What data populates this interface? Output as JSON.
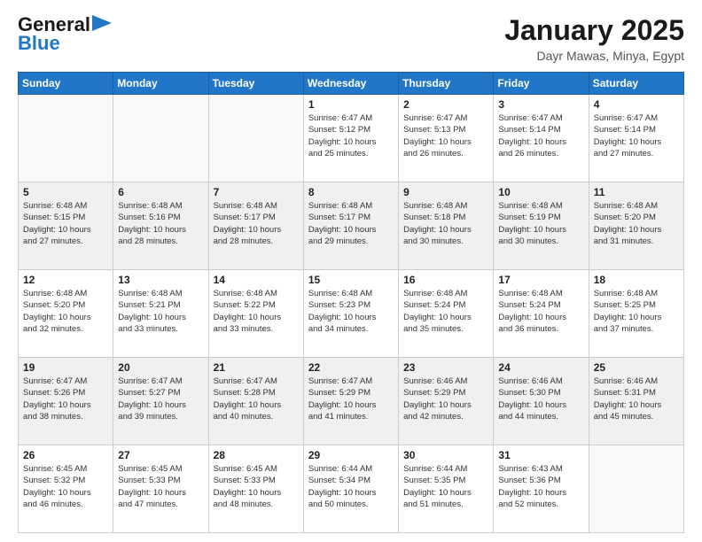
{
  "header": {
    "logo_line1": "General",
    "logo_line2": "Blue",
    "month_title": "January 2025",
    "location": "Dayr Mawas, Minya, Egypt"
  },
  "days_of_week": [
    "Sunday",
    "Monday",
    "Tuesday",
    "Wednesday",
    "Thursday",
    "Friday",
    "Saturday"
  ],
  "weeks": [
    [
      {
        "day": "",
        "info": ""
      },
      {
        "day": "",
        "info": ""
      },
      {
        "day": "",
        "info": ""
      },
      {
        "day": "1",
        "info": "Sunrise: 6:47 AM\nSunset: 5:12 PM\nDaylight: 10 hours\nand 25 minutes."
      },
      {
        "day": "2",
        "info": "Sunrise: 6:47 AM\nSunset: 5:13 PM\nDaylight: 10 hours\nand 26 minutes."
      },
      {
        "day": "3",
        "info": "Sunrise: 6:47 AM\nSunset: 5:14 PM\nDaylight: 10 hours\nand 26 minutes."
      },
      {
        "day": "4",
        "info": "Sunrise: 6:47 AM\nSunset: 5:14 PM\nDaylight: 10 hours\nand 27 minutes."
      }
    ],
    [
      {
        "day": "5",
        "info": "Sunrise: 6:48 AM\nSunset: 5:15 PM\nDaylight: 10 hours\nand 27 minutes."
      },
      {
        "day": "6",
        "info": "Sunrise: 6:48 AM\nSunset: 5:16 PM\nDaylight: 10 hours\nand 28 minutes."
      },
      {
        "day": "7",
        "info": "Sunrise: 6:48 AM\nSunset: 5:17 PM\nDaylight: 10 hours\nand 28 minutes."
      },
      {
        "day": "8",
        "info": "Sunrise: 6:48 AM\nSunset: 5:17 PM\nDaylight: 10 hours\nand 29 minutes."
      },
      {
        "day": "9",
        "info": "Sunrise: 6:48 AM\nSunset: 5:18 PM\nDaylight: 10 hours\nand 30 minutes."
      },
      {
        "day": "10",
        "info": "Sunrise: 6:48 AM\nSunset: 5:19 PM\nDaylight: 10 hours\nand 30 minutes."
      },
      {
        "day": "11",
        "info": "Sunrise: 6:48 AM\nSunset: 5:20 PM\nDaylight: 10 hours\nand 31 minutes."
      }
    ],
    [
      {
        "day": "12",
        "info": "Sunrise: 6:48 AM\nSunset: 5:20 PM\nDaylight: 10 hours\nand 32 minutes."
      },
      {
        "day": "13",
        "info": "Sunrise: 6:48 AM\nSunset: 5:21 PM\nDaylight: 10 hours\nand 33 minutes."
      },
      {
        "day": "14",
        "info": "Sunrise: 6:48 AM\nSunset: 5:22 PM\nDaylight: 10 hours\nand 33 minutes."
      },
      {
        "day": "15",
        "info": "Sunrise: 6:48 AM\nSunset: 5:23 PM\nDaylight: 10 hours\nand 34 minutes."
      },
      {
        "day": "16",
        "info": "Sunrise: 6:48 AM\nSunset: 5:24 PM\nDaylight: 10 hours\nand 35 minutes."
      },
      {
        "day": "17",
        "info": "Sunrise: 6:48 AM\nSunset: 5:24 PM\nDaylight: 10 hours\nand 36 minutes."
      },
      {
        "day": "18",
        "info": "Sunrise: 6:48 AM\nSunset: 5:25 PM\nDaylight: 10 hours\nand 37 minutes."
      }
    ],
    [
      {
        "day": "19",
        "info": "Sunrise: 6:47 AM\nSunset: 5:26 PM\nDaylight: 10 hours\nand 38 minutes."
      },
      {
        "day": "20",
        "info": "Sunrise: 6:47 AM\nSunset: 5:27 PM\nDaylight: 10 hours\nand 39 minutes."
      },
      {
        "day": "21",
        "info": "Sunrise: 6:47 AM\nSunset: 5:28 PM\nDaylight: 10 hours\nand 40 minutes."
      },
      {
        "day": "22",
        "info": "Sunrise: 6:47 AM\nSunset: 5:29 PM\nDaylight: 10 hours\nand 41 minutes."
      },
      {
        "day": "23",
        "info": "Sunrise: 6:46 AM\nSunset: 5:29 PM\nDaylight: 10 hours\nand 42 minutes."
      },
      {
        "day": "24",
        "info": "Sunrise: 6:46 AM\nSunset: 5:30 PM\nDaylight: 10 hours\nand 44 minutes."
      },
      {
        "day": "25",
        "info": "Sunrise: 6:46 AM\nSunset: 5:31 PM\nDaylight: 10 hours\nand 45 minutes."
      }
    ],
    [
      {
        "day": "26",
        "info": "Sunrise: 6:45 AM\nSunset: 5:32 PM\nDaylight: 10 hours\nand 46 minutes."
      },
      {
        "day": "27",
        "info": "Sunrise: 6:45 AM\nSunset: 5:33 PM\nDaylight: 10 hours\nand 47 minutes."
      },
      {
        "day": "28",
        "info": "Sunrise: 6:45 AM\nSunset: 5:33 PM\nDaylight: 10 hours\nand 48 minutes."
      },
      {
        "day": "29",
        "info": "Sunrise: 6:44 AM\nSunset: 5:34 PM\nDaylight: 10 hours\nand 50 minutes."
      },
      {
        "day": "30",
        "info": "Sunrise: 6:44 AM\nSunset: 5:35 PM\nDaylight: 10 hours\nand 51 minutes."
      },
      {
        "day": "31",
        "info": "Sunrise: 6:43 AM\nSunset: 5:36 PM\nDaylight: 10 hours\nand 52 minutes."
      },
      {
        "day": "",
        "info": ""
      }
    ]
  ]
}
